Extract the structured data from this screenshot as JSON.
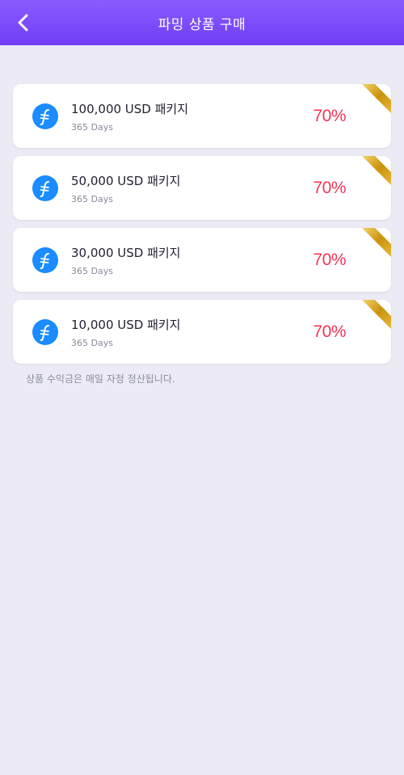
{
  "header": {
    "title": "파밍 상품 구매",
    "back_icon": "chevron-left-icon"
  },
  "packages": [
    {
      "name": "100,000 USD 패키지",
      "duration": "365 Days",
      "rate": "70%"
    },
    {
      "name": "50,000 USD 패키지",
      "duration": "365 Days",
      "rate": "70%"
    },
    {
      "name": "30,000 USD 패키지",
      "duration": "365 Days",
      "rate": "70%"
    },
    {
      "name": "10,000 USD 패키지",
      "duration": "365 Days",
      "rate": "70%"
    }
  ],
  "note": "상품 수익금은 매일 자정 정산됩니다.",
  "colors": {
    "header_start": "#8a5cff",
    "header_end": "#6f3ef5",
    "accent_rate": "#f2355a",
    "coin": "#1a8cff",
    "ribbon": "#d4a017",
    "background": "#ecebf5"
  },
  "icons": {
    "coin": "filecoin-icon",
    "ribbon": "gold-ribbon-icon"
  }
}
